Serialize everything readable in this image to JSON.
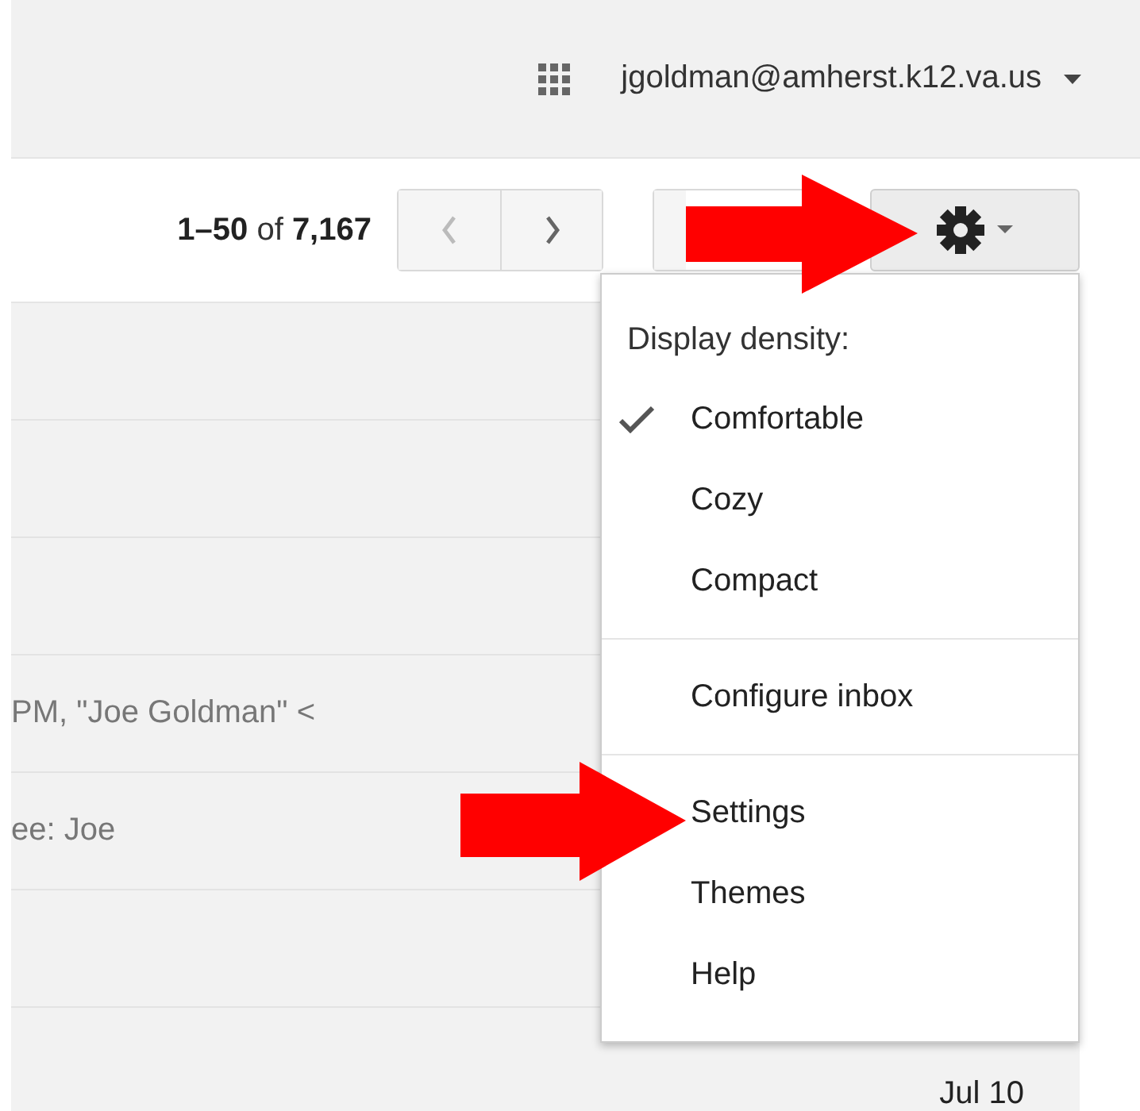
{
  "header": {
    "account": "jgoldman@amherst.k12.va.us"
  },
  "toolbar": {
    "page_range": "**1–50** of **7,167**"
  },
  "messages": [
    {
      "kind": "blank"
    },
    {
      "kind": "blank"
    },
    {
      "kind": "blank"
    },
    {
      "kind": "snippet",
      "snippet": "PM, \"Joe Goldman\" <"
    },
    {
      "kind": "snippet",
      "snippet": "ee: Joe"
    },
    {
      "kind": "blank"
    },
    {
      "kind": "date",
      "date": "Jul 10"
    }
  ],
  "settings_menu": {
    "heading": "Display density:",
    "groups": [
      [
        {
          "label": "Comfortable",
          "checked": true
        },
        {
          "label": "Cozy",
          "checked": false
        },
        {
          "label": "Compact",
          "checked": false
        }
      ],
      [
        {
          "label": "Configure inbox"
        }
      ],
      [
        {
          "label": "Settings"
        },
        {
          "label": "Themes"
        },
        {
          "label": "Help"
        }
      ]
    ]
  }
}
